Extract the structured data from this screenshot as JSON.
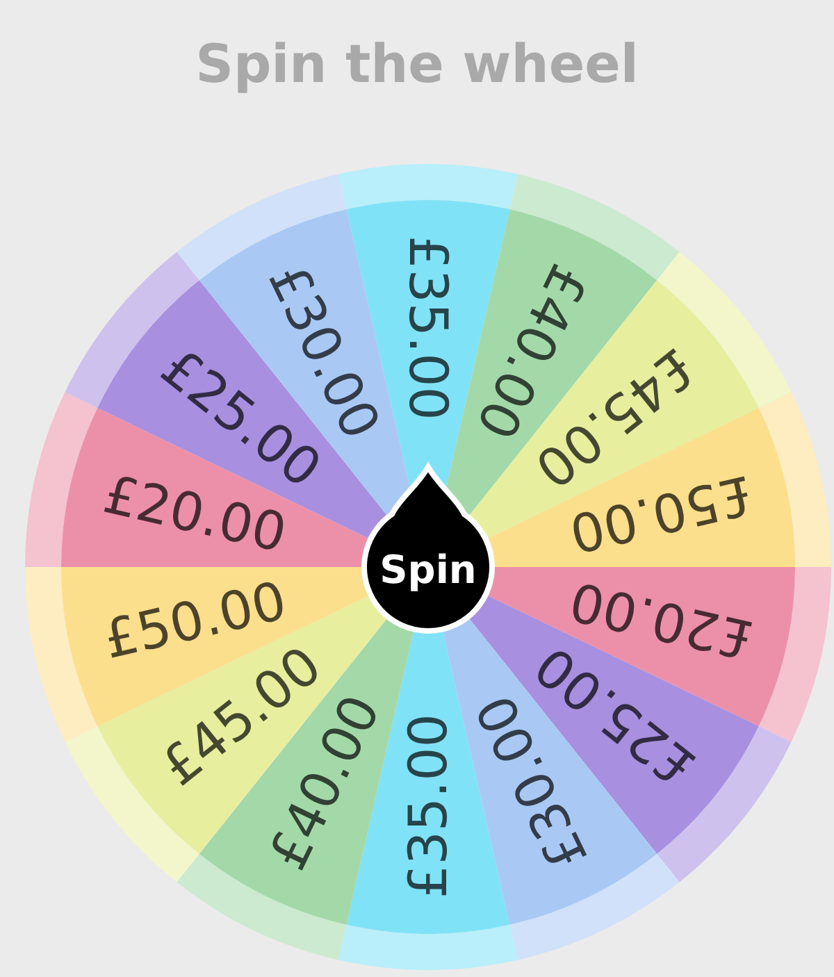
{
  "title": "Spin the wheel",
  "segments": [
    {
      "label": "£35.00",
      "color": "#80e2f6"
    },
    {
      "label": "£40.00",
      "color": "#a3d9a9"
    },
    {
      "label": "£45.00",
      "color": "#e7ef9f"
    },
    {
      "label": "£50.00",
      "color": "#fcdf8c"
    },
    {
      "label": "£20.00",
      "color": "#ec90a9"
    },
    {
      "label": "£25.00",
      "color": "#a88fe0"
    },
    {
      "label": "£30.00",
      "color": "#a9c9f4"
    },
    {
      "label": "£35.00",
      "color": "#80e2f6"
    },
    {
      "label": "£40.00",
      "color": "#a3d9a9"
    },
    {
      "label": "£45.00",
      "color": "#e7ef9f"
    },
    {
      "label": "£50.00",
      "color": "#fcdf8c"
    },
    {
      "label": "£20.00",
      "color": "#ec90a9"
    },
    {
      "label": "£25.00",
      "color": "#a88fe0"
    },
    {
      "label": "£30.00",
      "color": "#a9c9f4"
    }
  ],
  "spin_button": {
    "label": "Spin"
  }
}
